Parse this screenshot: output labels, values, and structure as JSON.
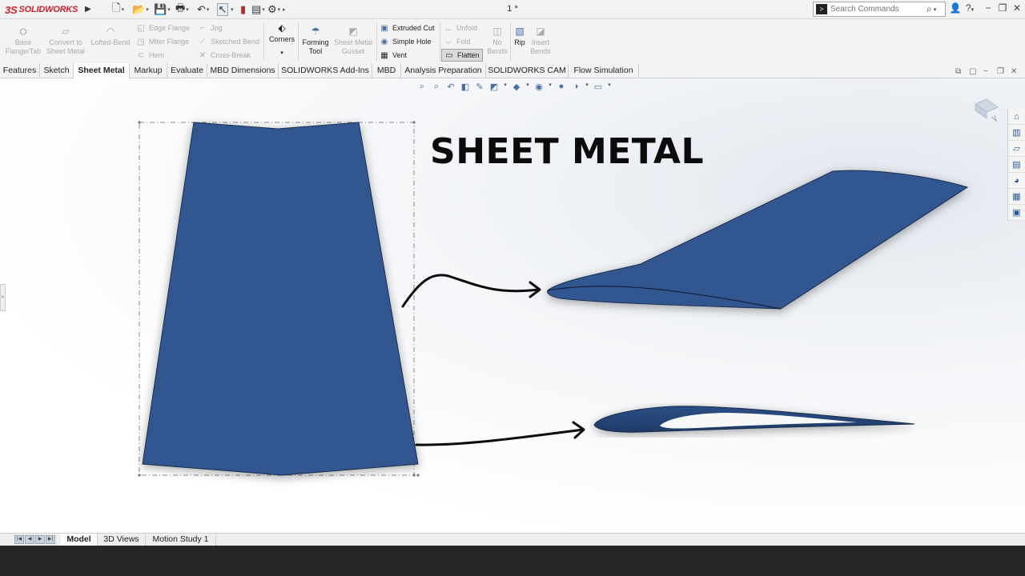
{
  "app": {
    "brand_ds": "3S",
    "brand_name": "SOLIDWORKS",
    "document_title": "1 *"
  },
  "search": {
    "placeholder": "Search Commands"
  },
  "ribbon": {
    "base_flange": "Base Flange/Tab",
    "convert": "Convert to Sheet Metal",
    "lofted_bend": "Lofted-Bend",
    "edge_flange": "Edge Flange",
    "miter_flange": "Miter Flange",
    "hem": "Hem",
    "jog": "Jog",
    "sketched_bend": "Sketched Bend",
    "cross_break": "Cross-Break",
    "corners": "Corners",
    "forming_tool": "Forming Tool",
    "sheet_metal_gusset": "Sheet Metal Gusset",
    "extruded_cut": "Extruded Cut",
    "simple_hole": "Simple Hole",
    "vent": "Vent",
    "unfold": "Unfold",
    "fold": "Fold",
    "flatten": "Flatten",
    "no_bends": "No Bends",
    "rip": "Rip",
    "insert_bends": "Insert Bends"
  },
  "tabs": [
    "Features",
    "Sketch",
    "Sheet Metal",
    "Markup",
    "Evaluate",
    "MBD Dimensions",
    "SOLIDWORKS Add-Ins",
    "MBD",
    "Analysis Preparation",
    "SOLIDWORKS CAM",
    "Flow Simulation"
  ],
  "active_tab": "Sheet Metal",
  "graphics": {
    "title_text": "SHEET METAL",
    "part_color": "#325790"
  },
  "bottom_tabs": [
    "Model",
    "3D Views",
    "Motion Study 1"
  ],
  "active_bottom_tab": "Model",
  "colors": {
    "brand_red": "#d0202a",
    "part_blue": "#325790",
    "arrow_black": "#0c0c0c"
  }
}
